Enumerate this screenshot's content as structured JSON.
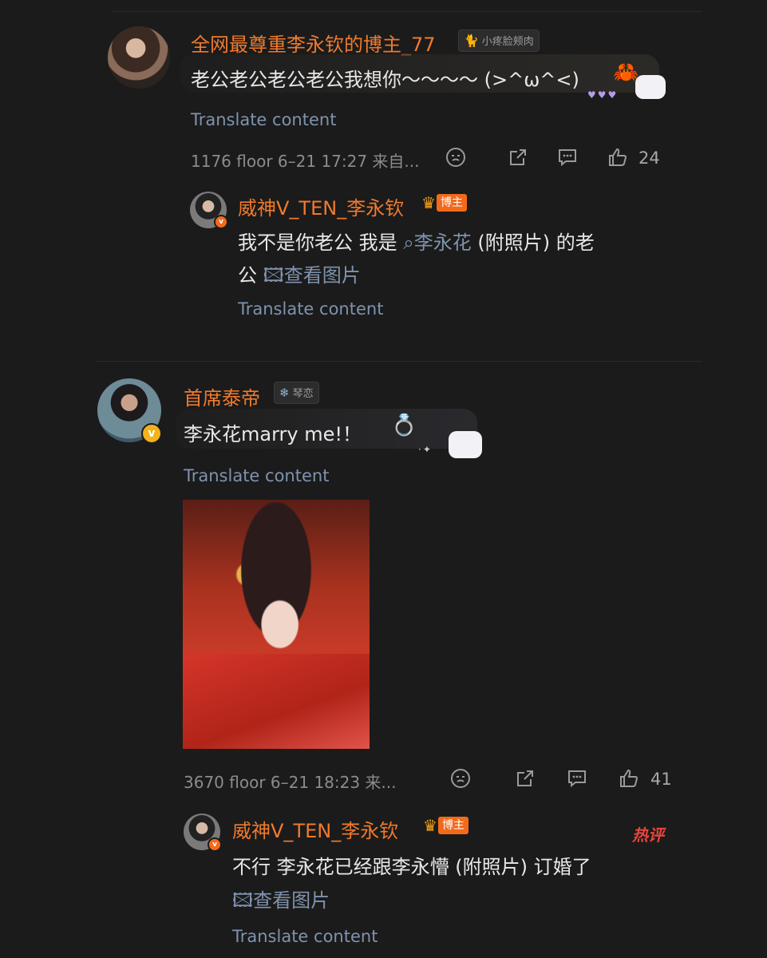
{
  "comments": [
    {
      "username": "全网最尊重李永钦的博主_77",
      "tag": "小疼脸颊肉",
      "text": "老公老公老公老公我想你～～～～ (>^ω^<)",
      "translate": "Translate content",
      "meta": "1176 floor 6–21 17:27 来自...",
      "likes": "24",
      "reply": {
        "username": "威神V_TEN_李永钦",
        "badge": "博主",
        "text_before": "我不是你老公 我是",
        "search_term": "李永花",
        "text_after": " (附照片) 的老",
        "line2_prefix": "公",
        "view_image": "查看图片",
        "translate": "Translate content"
      }
    },
    {
      "username": "首席泰帝",
      "tag": "琴恋",
      "text": "李永花marry me!！",
      "translate": "Translate content",
      "meta": "3670 floor 6–21 18:23 来...",
      "likes": "41",
      "reply": {
        "username": "威神V_TEN_李永钦",
        "badge": "博主",
        "hot_label": "热评",
        "text": "不行 李永花已经跟李永懵 (附照片) 订婚了",
        "view_image": "查看图片",
        "translate": "Translate content"
      }
    }
  ],
  "icons": [
    "emoji-icon",
    "share-icon",
    "comment-icon",
    "like-icon",
    "search-icon",
    "image-icon",
    "ring-icon",
    "verified-badge-icon",
    "crown-icon"
  ]
}
